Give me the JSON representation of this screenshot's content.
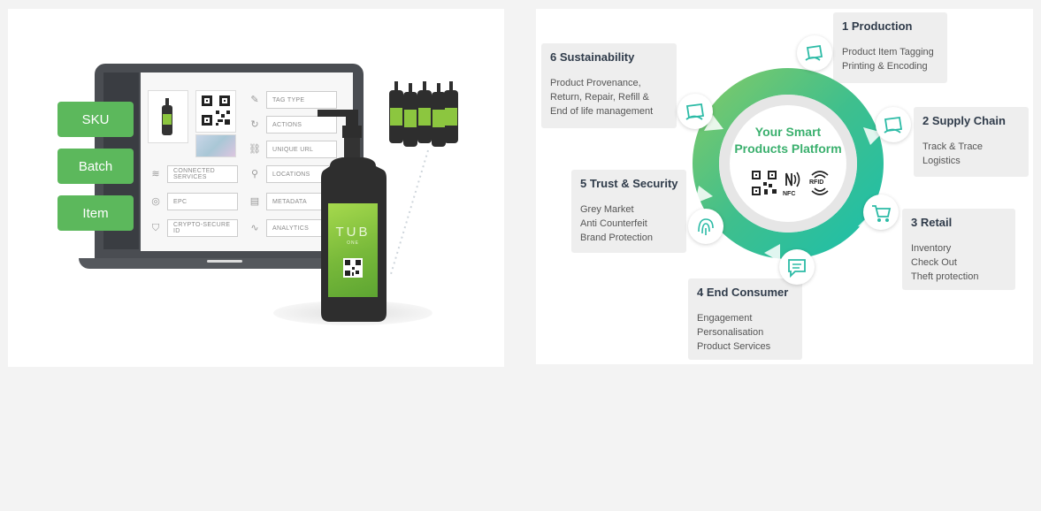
{
  "left": {
    "labels": [
      "SKU",
      "Batch",
      "Item"
    ],
    "fields": [
      "TAG TYPE",
      "ACTIONS",
      "UNIQUE URL",
      "CONNECTED SERVICES",
      "LOCATIONS",
      "EPC",
      "METADATA",
      "CRYPTO-SECURE ID",
      "ANALYTICS"
    ],
    "bottle": {
      "brand": "TUB",
      "sub": "ONE"
    },
    "colors": {
      "label_green": "#5cb85c",
      "laptop": "#4a4d52",
      "bottle": "#2e2e2e",
      "leaf": "#8cc63f"
    }
  },
  "right": {
    "center": {
      "line1": "Your Smart",
      "line2": "Products Platform",
      "nfc_label": "NFC",
      "rfid_label": "RFID"
    },
    "stages": [
      {
        "title": "1 Production",
        "lines": [
          "Product Item Tagging",
          "Printing & Encoding"
        ],
        "icon": "tag-hand-icon"
      },
      {
        "title": "2 Supply Chain",
        "lines": [
          "Track & Trace",
          "Logistics"
        ],
        "icon": "tag-hand-icon"
      },
      {
        "title": "3 Retail",
        "lines": [
          "Inventory",
          "Check Out",
          "Theft protection"
        ],
        "icon": "cart-icon"
      },
      {
        "title": "4 End Consumer",
        "lines": [
          "Engagement",
          "Personalisation",
          "Product Services"
        ],
        "icon": "chat-icon"
      },
      {
        "title": "5 Trust & Security",
        "lines": [
          "Grey Market",
          "Anti Counterfeit",
          "Brand Protection"
        ],
        "icon": "fingerprint-icon"
      },
      {
        "title": "6 Sustainability",
        "lines": [
          "Product Provenance,",
          "Return, Repair, Refill &",
          "End of life management"
        ],
        "icon": "tag-hand-icon"
      }
    ],
    "colors": {
      "title": "#2f3b4a",
      "accent": "#3bb06e",
      "ring_green": "#5dbf6a",
      "ring_teal": "#21c0a8",
      "box": "#eeeeee"
    }
  }
}
